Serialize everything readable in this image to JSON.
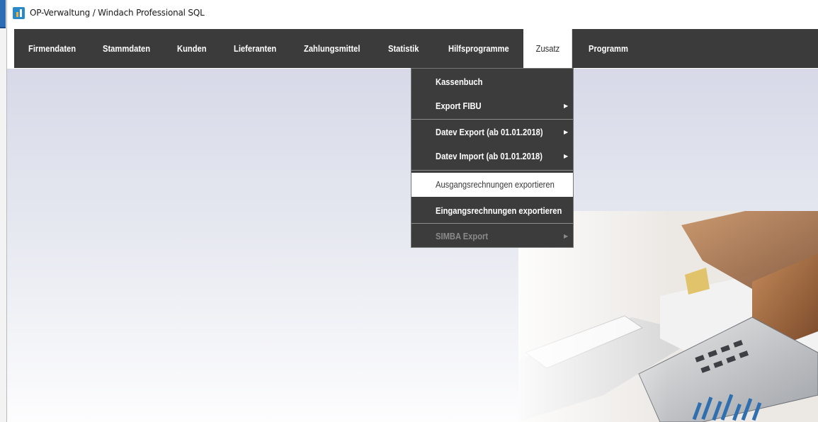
{
  "window": {
    "title": "OP-Verwaltung / Windach Professional SQL",
    "icon": "app-icon"
  },
  "menubar": {
    "items": [
      {
        "label": "Firmendaten"
      },
      {
        "label": "Stammdaten"
      },
      {
        "label": "Kunden"
      },
      {
        "label": "Lieferanten"
      },
      {
        "label": "Zahlungsmittel"
      },
      {
        "label": "Statistik"
      },
      {
        "label": "Hilfsprogramme"
      },
      {
        "label": "Zusatz"
      },
      {
        "label": "Programm"
      }
    ],
    "active": "Zusatz"
  },
  "dropdown": {
    "items": [
      {
        "label": "Kassenbuch"
      },
      {
        "label": "Export FIBU",
        "arrow": "▶"
      },
      {
        "label": "Datev Export (ab 01.01.2018)",
        "arrow": "▶"
      },
      {
        "label": "Datev Import (ab 01.01.2018)",
        "arrow": "▶"
      },
      {
        "label": "Ausgangsrechnungen exportieren",
        "highlighted": true
      },
      {
        "label": "Eingangsrechnungen exportieren"
      },
      {
        "label": "SIMBA Export",
        "arrow": "▶",
        "disabled": true
      }
    ]
  },
  "colors": {
    "menubar_bg": "#3b3b3b",
    "dropdown_bg": "#3c3c3c",
    "content_bg_top": "#d7d9e8",
    "accent": "#2d6db5"
  }
}
